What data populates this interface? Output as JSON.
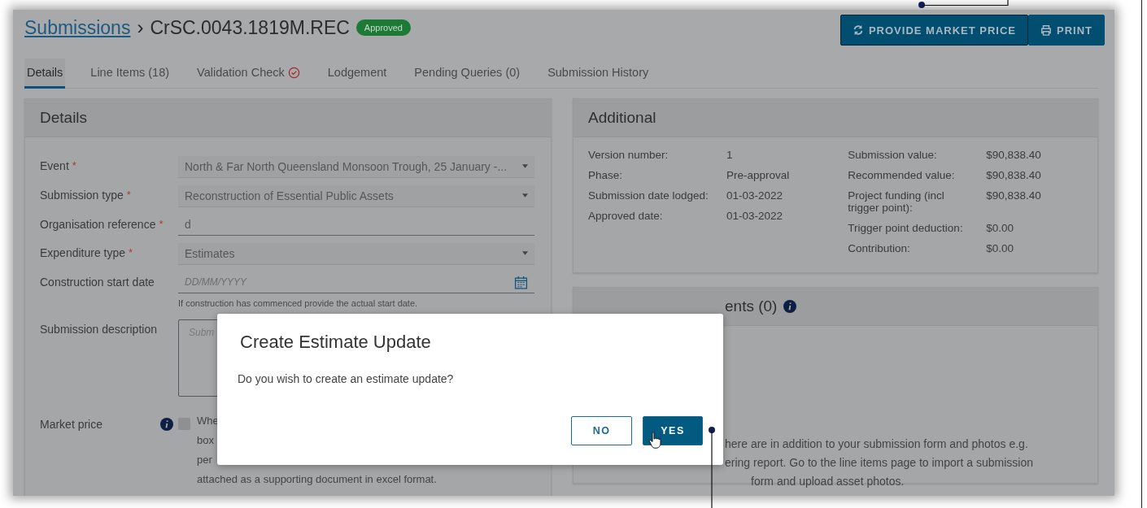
{
  "breadcrumb": {
    "link": "Submissions",
    "separator": "›",
    "current": "CrSC.0043.1819M.REC",
    "badge": "Approved"
  },
  "actions": [
    {
      "kind": "refresh",
      "label": "PROVIDE MARKET PRICE",
      "focused": true
    },
    {
      "kind": "print",
      "label": "PRINT",
      "focused": false
    }
  ],
  "tabs": [
    {
      "label": "Details",
      "selected": true,
      "validated": false
    },
    {
      "label": "Line Items (18)",
      "selected": false,
      "validated": false
    },
    {
      "label": "Validation Check",
      "selected": false,
      "validated": true
    },
    {
      "label": "Lodgement",
      "selected": false,
      "validated": false
    },
    {
      "label": "Pending Queries (0)",
      "selected": false,
      "validated": false
    },
    {
      "label": "Submission History",
      "selected": false,
      "validated": false
    }
  ],
  "details_panel": {
    "title": "Details",
    "required_mark": "*",
    "fields": [
      {
        "kind": "select",
        "label": "Event",
        "required": true,
        "value": "North & Far North Queensland Monsoon Trough, 25 January -..."
      },
      {
        "kind": "select",
        "label": "Submission type",
        "required": true,
        "value": "Reconstruction of Essential Public Assets"
      },
      {
        "kind": "text",
        "label": "Organisation reference",
        "required": true,
        "value": "d"
      },
      {
        "kind": "select",
        "label": "Expenditure type",
        "required": true,
        "value": "Estimates"
      },
      {
        "kind": "date",
        "label": "Construction start date",
        "required": false,
        "placeholder": "DD/MM/YYYY",
        "hint": "If construction has commenced provide the actual start date."
      },
      {
        "kind": "textarea",
        "label": "Submission description",
        "required": false,
        "placeholder": "Subm"
      },
      {
        "kind": "checkbox",
        "label": "Market price",
        "required": false,
        "checked": false,
        "lines": [
          "Whe",
          "box",
          "per",
          "attached as a supporting document in excel format."
        ]
      }
    ]
  },
  "additional_panel": {
    "title": "Additional",
    "left": [
      {
        "label": "Version number:",
        "value": "1"
      },
      {
        "label": "Phase:",
        "value": "Pre-approval"
      },
      {
        "label": "Submission date lodged:",
        "value": "01-03-2022"
      },
      {
        "label": "Approved date:",
        "value": "01-03-2022"
      }
    ],
    "right": [
      {
        "label": "Submission value:",
        "value": "$90,838.40"
      },
      {
        "label": "Recommended value:",
        "value": "$90,838.40"
      },
      {
        "label": "Project funding (incl trigger point):",
        "value": "$90,838.40"
      },
      {
        "label": "Trigger point deduction:",
        "value": "$0.00"
      },
      {
        "label": "Contribution:",
        "value": "$0.00"
      }
    ]
  },
  "documents_panel": {
    "title": "ents (0)",
    "lines": [
      "here are in addition to your submission form and photos e.g.",
      "ering report. Go to the line items page to import a submission",
      "form and upload asset photos."
    ]
  },
  "dialog": {
    "title": "Create Estimate Update",
    "message": "Do you wish to create an estimate update?",
    "buttons": [
      {
        "label": "NO",
        "kind": "secondary"
      },
      {
        "label": "YES",
        "kind": "primary"
      }
    ]
  }
}
